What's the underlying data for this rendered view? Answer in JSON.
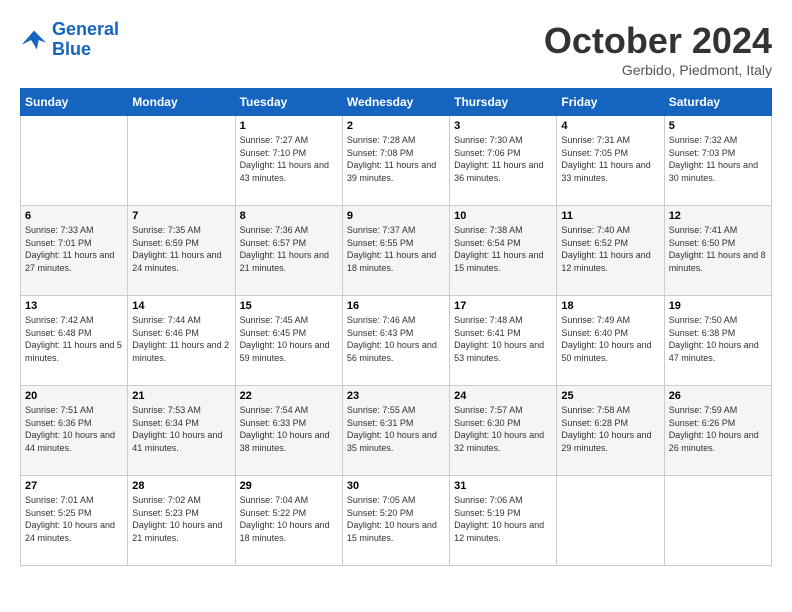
{
  "header": {
    "logo_line1": "General",
    "logo_line2": "Blue",
    "month": "October 2024",
    "location": "Gerbido, Piedmont, Italy"
  },
  "weekdays": [
    "Sunday",
    "Monday",
    "Tuesday",
    "Wednesday",
    "Thursday",
    "Friday",
    "Saturday"
  ],
  "weeks": [
    [
      {
        "day": "",
        "info": ""
      },
      {
        "day": "",
        "info": ""
      },
      {
        "day": "1",
        "info": "Sunrise: 7:27 AM\nSunset: 7:10 PM\nDaylight: 11 hours and 43 minutes."
      },
      {
        "day": "2",
        "info": "Sunrise: 7:28 AM\nSunset: 7:08 PM\nDaylight: 11 hours and 39 minutes."
      },
      {
        "day": "3",
        "info": "Sunrise: 7:30 AM\nSunset: 7:06 PM\nDaylight: 11 hours and 36 minutes."
      },
      {
        "day": "4",
        "info": "Sunrise: 7:31 AM\nSunset: 7:05 PM\nDaylight: 11 hours and 33 minutes."
      },
      {
        "day": "5",
        "info": "Sunrise: 7:32 AM\nSunset: 7:03 PM\nDaylight: 11 hours and 30 minutes."
      }
    ],
    [
      {
        "day": "6",
        "info": "Sunrise: 7:33 AM\nSunset: 7:01 PM\nDaylight: 11 hours and 27 minutes."
      },
      {
        "day": "7",
        "info": "Sunrise: 7:35 AM\nSunset: 6:59 PM\nDaylight: 11 hours and 24 minutes."
      },
      {
        "day": "8",
        "info": "Sunrise: 7:36 AM\nSunset: 6:57 PM\nDaylight: 11 hours and 21 minutes."
      },
      {
        "day": "9",
        "info": "Sunrise: 7:37 AM\nSunset: 6:55 PM\nDaylight: 11 hours and 18 minutes."
      },
      {
        "day": "10",
        "info": "Sunrise: 7:38 AM\nSunset: 6:54 PM\nDaylight: 11 hours and 15 minutes."
      },
      {
        "day": "11",
        "info": "Sunrise: 7:40 AM\nSunset: 6:52 PM\nDaylight: 11 hours and 12 minutes."
      },
      {
        "day": "12",
        "info": "Sunrise: 7:41 AM\nSunset: 6:50 PM\nDaylight: 11 hours and 8 minutes."
      }
    ],
    [
      {
        "day": "13",
        "info": "Sunrise: 7:42 AM\nSunset: 6:48 PM\nDaylight: 11 hours and 5 minutes."
      },
      {
        "day": "14",
        "info": "Sunrise: 7:44 AM\nSunset: 6:46 PM\nDaylight: 11 hours and 2 minutes."
      },
      {
        "day": "15",
        "info": "Sunrise: 7:45 AM\nSunset: 6:45 PM\nDaylight: 10 hours and 59 minutes."
      },
      {
        "day": "16",
        "info": "Sunrise: 7:46 AM\nSunset: 6:43 PM\nDaylight: 10 hours and 56 minutes."
      },
      {
        "day": "17",
        "info": "Sunrise: 7:48 AM\nSunset: 6:41 PM\nDaylight: 10 hours and 53 minutes."
      },
      {
        "day": "18",
        "info": "Sunrise: 7:49 AM\nSunset: 6:40 PM\nDaylight: 10 hours and 50 minutes."
      },
      {
        "day": "19",
        "info": "Sunrise: 7:50 AM\nSunset: 6:38 PM\nDaylight: 10 hours and 47 minutes."
      }
    ],
    [
      {
        "day": "20",
        "info": "Sunrise: 7:51 AM\nSunset: 6:36 PM\nDaylight: 10 hours and 44 minutes."
      },
      {
        "day": "21",
        "info": "Sunrise: 7:53 AM\nSunset: 6:34 PM\nDaylight: 10 hours and 41 minutes."
      },
      {
        "day": "22",
        "info": "Sunrise: 7:54 AM\nSunset: 6:33 PM\nDaylight: 10 hours and 38 minutes."
      },
      {
        "day": "23",
        "info": "Sunrise: 7:55 AM\nSunset: 6:31 PM\nDaylight: 10 hours and 35 minutes."
      },
      {
        "day": "24",
        "info": "Sunrise: 7:57 AM\nSunset: 6:30 PM\nDaylight: 10 hours and 32 minutes."
      },
      {
        "day": "25",
        "info": "Sunrise: 7:58 AM\nSunset: 6:28 PM\nDaylight: 10 hours and 29 minutes."
      },
      {
        "day": "26",
        "info": "Sunrise: 7:59 AM\nSunset: 6:26 PM\nDaylight: 10 hours and 26 minutes."
      }
    ],
    [
      {
        "day": "27",
        "info": "Sunrise: 7:01 AM\nSunset: 5:25 PM\nDaylight: 10 hours and 24 minutes."
      },
      {
        "day": "28",
        "info": "Sunrise: 7:02 AM\nSunset: 5:23 PM\nDaylight: 10 hours and 21 minutes."
      },
      {
        "day": "29",
        "info": "Sunrise: 7:04 AM\nSunset: 5:22 PM\nDaylight: 10 hours and 18 minutes."
      },
      {
        "day": "30",
        "info": "Sunrise: 7:05 AM\nSunset: 5:20 PM\nDaylight: 10 hours and 15 minutes."
      },
      {
        "day": "31",
        "info": "Sunrise: 7:06 AM\nSunset: 5:19 PM\nDaylight: 10 hours and 12 minutes."
      },
      {
        "day": "",
        "info": ""
      },
      {
        "day": "",
        "info": ""
      }
    ]
  ]
}
